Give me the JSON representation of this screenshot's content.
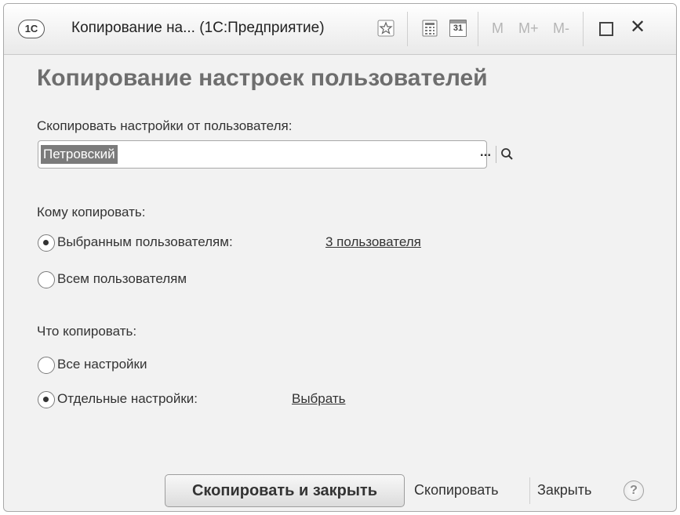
{
  "window": {
    "logo_text": "1С",
    "title": "Копирование на...  (1С:Предприятие)",
    "toolbar_icons": [
      "favorites-star-icon",
      "calculator-icon",
      "calendar-icon"
    ],
    "calendar_day": "31",
    "memory_buttons": [
      "M",
      "M+",
      "M-"
    ],
    "maximize_icon": "maximize-icon",
    "close_label": "✕"
  },
  "form": {
    "heading": "Копирование настроек пользователей",
    "source_user": {
      "label": "Скопировать настройки от пользователя:",
      "value": "Петровский",
      "select_label": "..."
    },
    "recipients": {
      "label": "Кому копировать:",
      "options": [
        {
          "label": "Выбранным пользователям:",
          "selected": true,
          "link": "3 пользователя"
        },
        {
          "label": "Всем пользователям",
          "selected": false
        }
      ]
    },
    "what": {
      "label": "Что копировать:",
      "options": [
        {
          "label": "Все настройки",
          "selected": false
        },
        {
          "label": "Отдельные настройки:",
          "selected": true,
          "link": "Выбрать"
        }
      ]
    }
  },
  "footer": {
    "copy_and_close": "Скопировать и закрыть",
    "copy": "Скопировать",
    "close": "Закрыть",
    "help": "?"
  }
}
